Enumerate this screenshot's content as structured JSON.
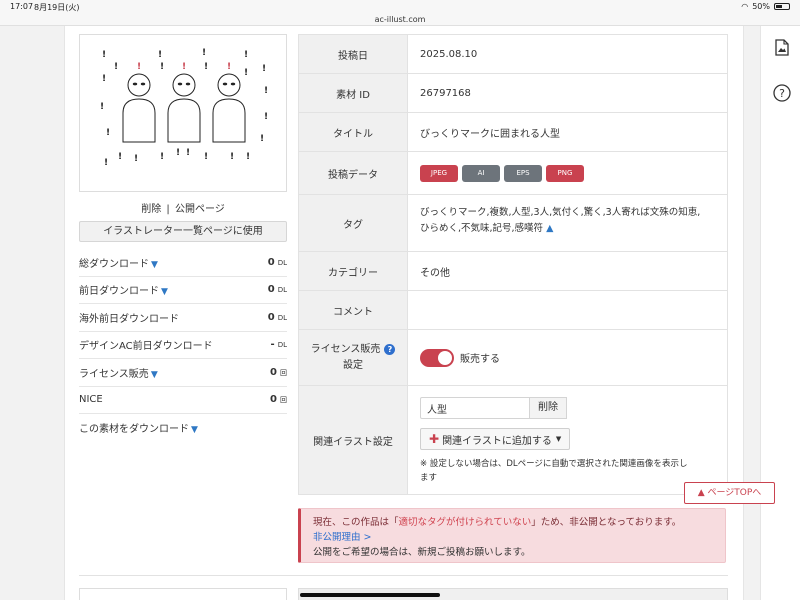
{
  "status": {
    "time": "17:07",
    "date": "8月19日(火)",
    "battery": "50%",
    "url": "ac-illust.com"
  },
  "thumb_links": {
    "delete": "削除",
    "sep": "|",
    "public": "公開ページ"
  },
  "use_button": "イラストレーター一覧ページに使用",
  "stats": [
    {
      "label": "総ダウンロード",
      "arrow": "▼",
      "value": "0",
      "unit": "DL"
    },
    {
      "label": "前日ダウンロード",
      "arrow": "▼",
      "value": "0",
      "unit": "DL"
    },
    {
      "label": "海外前日ダウンロード",
      "arrow": "",
      "value": "0",
      "unit": "DL"
    },
    {
      "label": "デザインAC前日ダウンロード",
      "arrow": "",
      "value": "-",
      "unit": "DL"
    },
    {
      "label": "ライセンス販売",
      "arrow": "▼",
      "value": "0",
      "unit": "回"
    },
    {
      "label": "NICE",
      "arrow": "",
      "value": "0",
      "unit": "回"
    },
    {
      "label": "この素材をダウンロード",
      "arrow": "▼",
      "value": "",
      "unit": ""
    }
  ],
  "table": {
    "post_date": {
      "label": "投稿日",
      "value": "2025.08.10"
    },
    "material_id": {
      "label": "素材 ID",
      "value": "26797168"
    },
    "title": {
      "label": "タイトル",
      "value": "びっくりマークに囲まれる人型"
    },
    "post_data": {
      "label": "投稿データ",
      "formats": [
        "JPEG",
        "AI",
        "EPS",
        "PNG"
      ]
    },
    "tags": {
      "label": "タグ",
      "line1": "びっくりマーク,複数,人型,3人,気付く,驚く,3人寄れば文殊の知恵,",
      "line2": "ひらめく,不気味,記号,感嘆符",
      "toggle": "▲"
    },
    "category": {
      "label": "カテゴリー",
      "value": "その他"
    },
    "comment": {
      "label": "コメント",
      "value": ""
    },
    "license": {
      "label_line1": "ライセンス販売",
      "label_line2": "設定",
      "help": "?",
      "value": "販売する"
    },
    "related": {
      "label": "関連イラスト設定",
      "input_value": "人型",
      "delete": "削除",
      "add": "関連イラストに追加する",
      "note_line1": "※ 設定しない場合は、DLページに自動で選択された関連画像を表示し",
      "note_line2": "ます"
    }
  },
  "alert": {
    "pre": "現在、この作品は「",
    "highlight": "適切なタグが付けられていない",
    "post": "」ため、非公開となっております。",
    "link": "非公開理由 >",
    "line3": "公開をご希望の場合は、新規ご投稿お願いします。"
  },
  "page_top": "▲ ページTOPへ",
  "colors": {
    "accent": "#c9424f",
    "link": "#2f78c4",
    "header_bg": "#f0f0f0",
    "alert_bg": "#f7dcdf"
  }
}
